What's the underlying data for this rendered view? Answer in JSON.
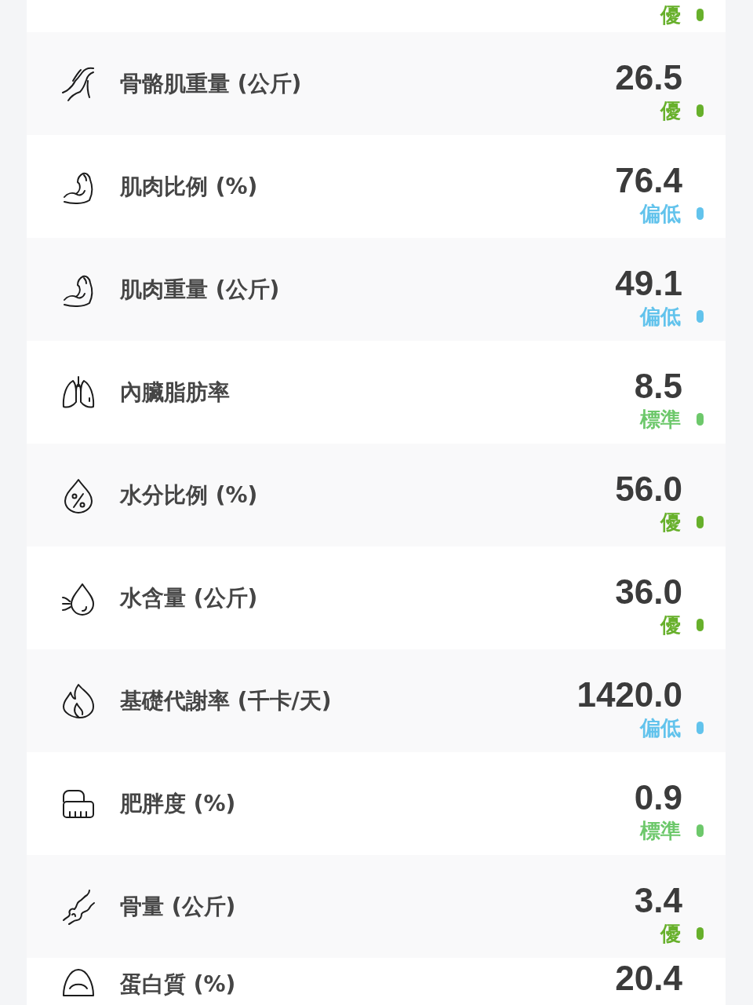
{
  "top_row": {
    "status": "優",
    "color": "#67b02b"
  },
  "rows": [
    {
      "label": "骨骼肌重量 (公斤)",
      "value": "26.5",
      "status": "優",
      "color": "#67b02b"
    },
    {
      "label": "肌肉比例 (%)",
      "value": "76.4",
      "status": "偏低",
      "color": "#62c3ec"
    },
    {
      "label": "肌肉重量 (公斤)",
      "value": "49.1",
      "status": "偏低",
      "color": "#62c3ec"
    },
    {
      "label": "內臟脂肪率",
      "value": "8.5",
      "status": "標準",
      "color": "#6dc86b"
    },
    {
      "label": "水分比例 (%)",
      "value": "56.0",
      "status": "優",
      "color": "#67b02b"
    },
    {
      "label": "水含量 (公斤)",
      "value": "36.0",
      "status": "優",
      "color": "#67b02b"
    },
    {
      "label": "基礎代謝率 (千卡/天)",
      "value": "1420.0",
      "status": "偏低",
      "color": "#62c3ec"
    },
    {
      "label": "肥胖度 (%)",
      "value": "0.9",
      "status": "標準",
      "color": "#6dc86b"
    },
    {
      "label": "骨量 (公斤)",
      "value": "3.4",
      "status": "優",
      "color": "#67b02b"
    }
  ],
  "bottom_row": {
    "label": "蛋白質 (%)",
    "value": "20.4"
  }
}
